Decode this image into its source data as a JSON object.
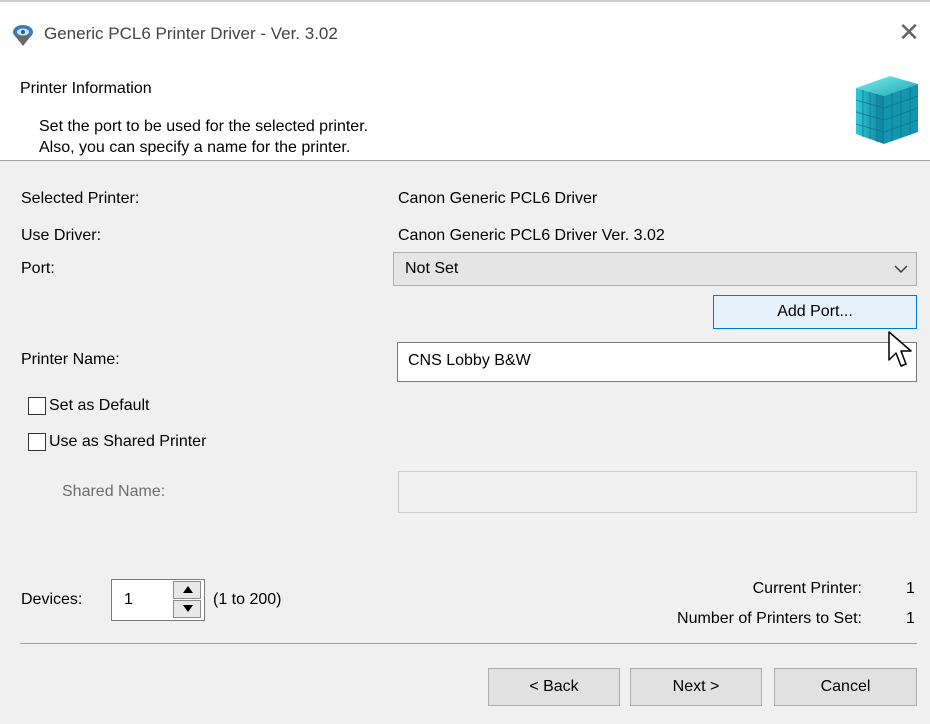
{
  "window": {
    "title": "Generic PCL6 Printer Driver - Ver. 3.02",
    "close_icon": "close-icon",
    "app_icon": "printer-driver-icon"
  },
  "header": {
    "title": "Printer Information",
    "description_line1": "Set the port to be used for the selected printer.",
    "description_line2": "Also, you can specify a name for the printer.",
    "logo_icon": "cube-logo-icon"
  },
  "form": {
    "selected_printer_label": "Selected Printer:",
    "selected_printer_value": "Canon Generic PCL6 Driver",
    "use_driver_label": "Use Driver:",
    "use_driver_value": "Canon Generic PCL6 Driver Ver. 3.02",
    "port_label": "Port:",
    "port_value": "Not Set",
    "add_port_label": "Add Port...",
    "printer_name_label": "Printer Name:",
    "printer_name_value": "CNS Lobby B&W",
    "set_default_label": "Set as Default",
    "set_default_checked": false,
    "shared_printer_label": "Use as Shared Printer",
    "shared_printer_checked": false,
    "shared_name_label": "Shared Name:",
    "shared_name_value": ""
  },
  "devices": {
    "label": "Devices:",
    "value": "1",
    "range": "(1 to 200)",
    "current_printer_label": "Current Printer:",
    "current_printer_value": "1",
    "printers_to_set_label": "Number of Printers to Set:",
    "printers_to_set_value": "1"
  },
  "buttons": {
    "back": "< Back",
    "next": "Next >",
    "cancel": "Cancel"
  },
  "colors": {
    "accent": "#0078d7",
    "dialog_bg": "#f0f0f0",
    "header_bg": "#ffffff",
    "disabled_text": "#6d6d6d"
  }
}
